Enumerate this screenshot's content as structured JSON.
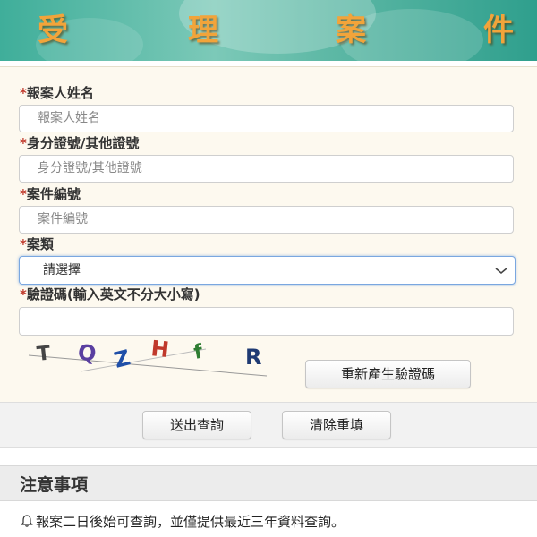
{
  "banner": {
    "title_chars": [
      "受",
      "理",
      "案",
      "件"
    ]
  },
  "form": {
    "reporter_name": {
      "label": "報案人姓名",
      "placeholder": "報案人姓名",
      "required_mark": "*"
    },
    "id_number": {
      "label": "身分證號/其他證號",
      "placeholder": "身分證號/其他證號",
      "required_mark": "*"
    },
    "case_number": {
      "label": "案件編號",
      "placeholder": "案件編號",
      "required_mark": "*"
    },
    "case_type": {
      "label": "案類",
      "selected": "請選擇",
      "required_mark": "*"
    },
    "captcha_field": {
      "label": "驗證碼(輸入英文不分大小寫)",
      "value": "",
      "required_mark": "*"
    },
    "captcha_image": {
      "chars": [
        "T",
        "Q",
        "Z",
        "H",
        "f",
        "R"
      ]
    },
    "regenerate_label": "重新產生驗證碼"
  },
  "actions": {
    "submit_label": "送出查詢",
    "reset_label": "清除重填"
  },
  "notice": {
    "heading": "注意事項",
    "lines": [
      "報案二日後始可查詢，並僅提供最近三年資料查詢。"
    ]
  },
  "colors": {
    "banner_teal": "#3fae9a",
    "title_orange": "#f2a43a",
    "required_red": "#c0392b",
    "form_bg": "#fdf9ef"
  }
}
